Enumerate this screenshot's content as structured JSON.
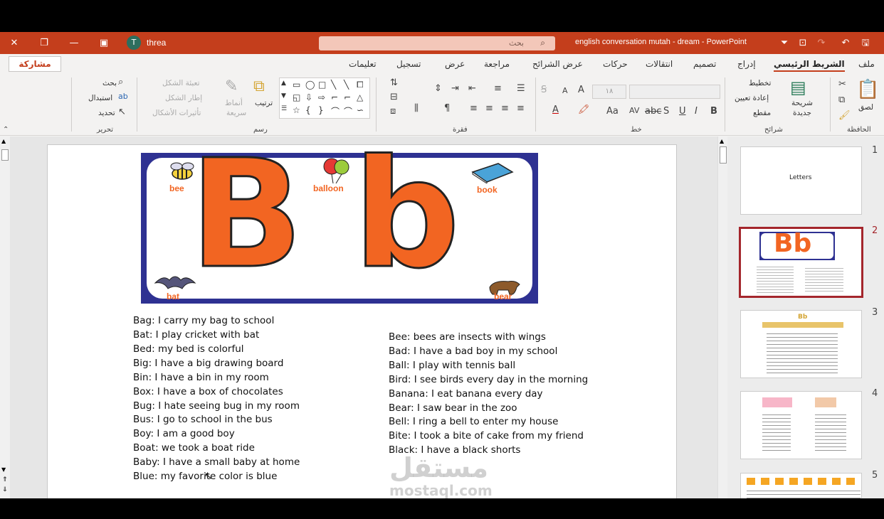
{
  "titlebar": {
    "doc_title": "english conversation mutah - dream  -  PowerPoint",
    "search_placeholder": "بحث",
    "user_initial": "T",
    "user_name": "threa"
  },
  "ribbon_tabs": {
    "file": "ملف",
    "home": "الشريط الرئيسي",
    "insert": "إدراج",
    "design": "تصميم",
    "transitions": "انتقالات",
    "animations": "حركات",
    "slideshow": "عرض الشرائح",
    "review": "مراجعة",
    "view": "عرض",
    "record": "تسجيل",
    "help": "تعليمات",
    "share": "مشاركة"
  },
  "ribbon": {
    "clipboard": {
      "label": "الحافظة",
      "paste": "لصق"
    },
    "slides": {
      "label": "شرائح",
      "new_slide": "شريحة",
      "new_slide_2": "جديدة",
      "layout": "تخطيط",
      "reset": "إعادة تعيين",
      "section": "مقطع"
    },
    "font": {
      "label": "خط",
      "size": "١٨"
    },
    "paragraph": {
      "label": "فقرة"
    },
    "drawing": {
      "label": "رسم",
      "arrange": "ترتيب",
      "styles": "أنماط",
      "styles_2": "سريعة",
      "fill": "تعبئة الشكل",
      "outline": "إطار الشكل",
      "effects": "تأثيرات الأشكال"
    },
    "editing": {
      "label": "تحرير",
      "find": "بحث",
      "replace": "استبدال",
      "select": "تحديد"
    }
  },
  "slide": {
    "banner": {
      "letters": "Bb",
      "labels": {
        "bee": "bee",
        "balloon": "balloon",
        "book": "book",
        "bat": "bat",
        "bear": "bear"
      }
    },
    "left_column": [
      "Bag: I carry my bag to school",
      "Bat: I play cricket with bat",
      "Bed: my bed is colorful",
      "Big: I have a big drawing board",
      "Bin: I have a bin in my room",
      "Box: I have a box of chocolates",
      "Bug: I hate seeing bug in my room",
      "Bus: I go to school in the bus",
      "Boy: I am a good boy",
      "Boat: we took a boat ride",
      "Baby: I have a small baby at home",
      "Blue: my favorite color is blue"
    ],
    "right_column": [
      "Bee: bees are insects with wings",
      "Bad: I have a bad boy in my school",
      "Ball: I play with tennis ball",
      "Bird: I see birds every day in the morning",
      "Banana: I eat banana every day",
      "Bear: I saw bear in the zoo",
      "Bell: I ring a bell to enter my house",
      "Bite: I took a bite of cake from my friend",
      "Black: I have a black shorts"
    ]
  },
  "thumbnails": [
    {
      "num": "1",
      "text": "Letters"
    },
    {
      "num": "2",
      "text": "Bb"
    },
    {
      "num": "3",
      "text": "Bb"
    },
    {
      "num": "4",
      "text": ""
    },
    {
      "num": "5",
      "text": ""
    }
  ],
  "watermark": {
    "arabic": "مستقل",
    "latin": "mostaql.com"
  },
  "colors": {
    "accent": "#c43e1c",
    "letter_orange": "#f26522",
    "banner_blue": "#2e3192",
    "selected_border": "#a4262c"
  }
}
